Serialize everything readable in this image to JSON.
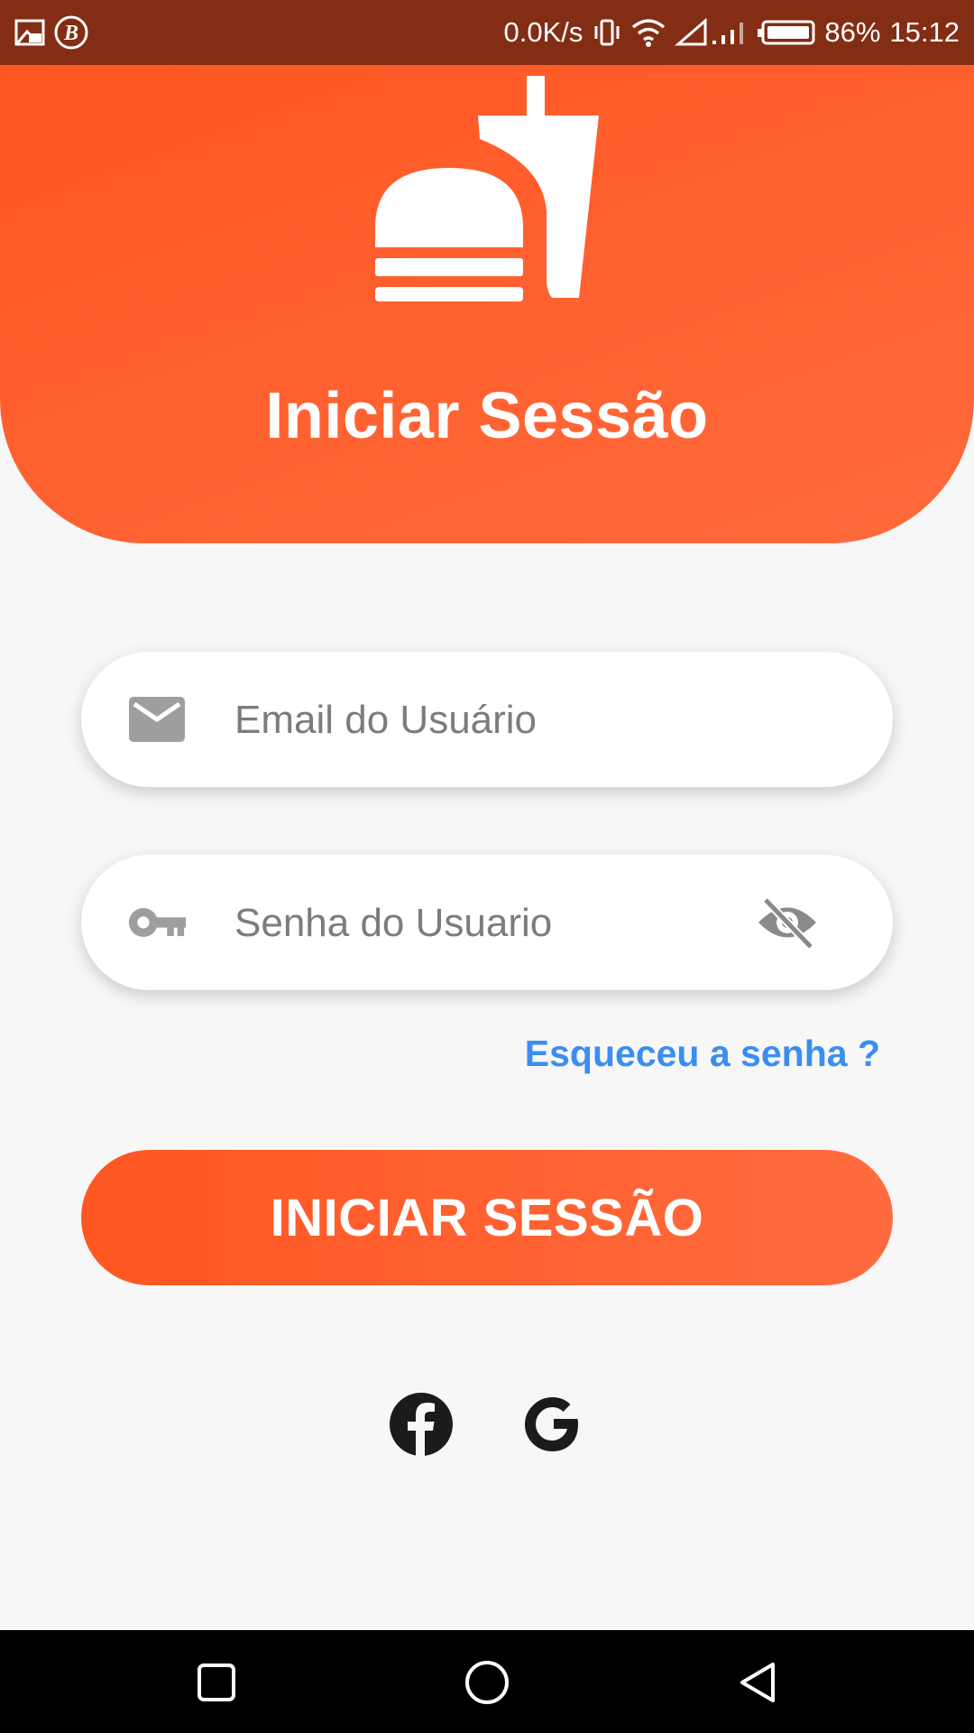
{
  "status_bar": {
    "network_speed": "0.0K/s",
    "battery": "86%",
    "time": "15:12",
    "left_icons": [
      "screen-cast-icon",
      "b-app-icon"
    ],
    "right_icons": [
      "vibrate-icon",
      "wifi-icon",
      "signal-icon",
      "battery-icon"
    ]
  },
  "header": {
    "logo_icon": "burger-drink-icon",
    "title": "Iniciar Sessão",
    "gradient": [
      "#ff5722",
      "#ff6a3c"
    ]
  },
  "form": {
    "email": {
      "placeholder": "Email do Usuário",
      "value": "",
      "icon": "mail-icon"
    },
    "password": {
      "placeholder": "Senha do Usuario",
      "value": "",
      "icon": "key-icon",
      "toggle_icon": "eye-off-icon"
    },
    "forgot_password": "Esqueceu a senha ?",
    "submit_label": "INICIAR SESSÃO"
  },
  "social": {
    "items": [
      "facebook-icon",
      "google-icon"
    ]
  },
  "nav_bar": {
    "items": [
      "recent-apps-icon",
      "home-icon",
      "back-icon"
    ]
  },
  "colors": {
    "accent": "#ff5722",
    "status_bar": "#832d14",
    "link": "#3b8ef0",
    "background": "#f7f7f7"
  }
}
